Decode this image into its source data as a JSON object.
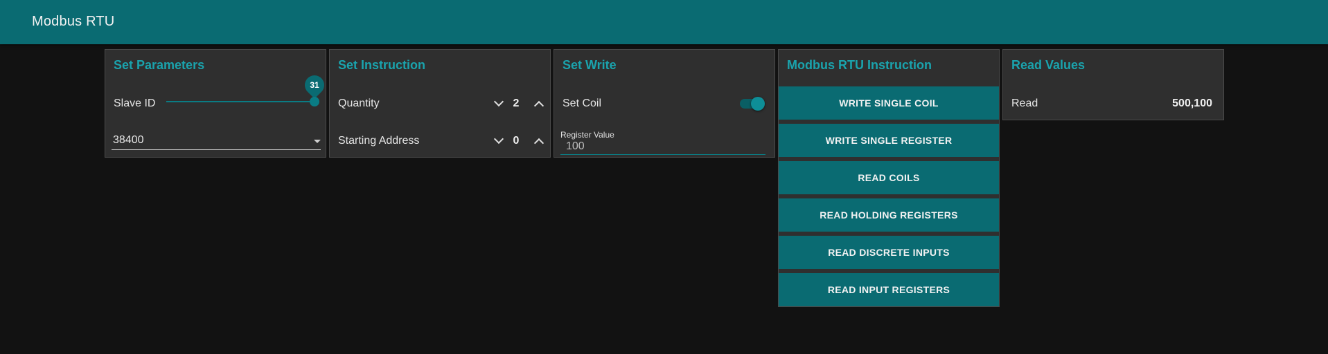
{
  "app": {
    "title": "Modbus RTU"
  },
  "set_parameters": {
    "title": "Set Parameters",
    "slave_id_label": "Slave ID",
    "slave_id_value": "31",
    "baud_rate": "38400"
  },
  "set_instruction": {
    "title": "Set Instruction",
    "quantity_label": "Quantity",
    "quantity_value": "2",
    "starting_address_label": "Starting Address",
    "starting_address_value": "0"
  },
  "set_write": {
    "title": "Set Write",
    "set_coil_label": "Set Coil",
    "set_coil_on": true,
    "register_value_label": "Register Value",
    "register_value": "100"
  },
  "instruction": {
    "title": "Modbus RTU Instruction",
    "buttons": [
      "WRITE SINGLE COIL",
      "WRITE SINGLE REGISTER",
      "READ COILS",
      "READ HOLDING REGISTERS",
      "READ DISCRETE INPUTS",
      "READ INPUT REGISTERS"
    ]
  },
  "read_values": {
    "title": "Read Values",
    "read_label": "Read",
    "read_value": "500,100"
  },
  "colors": {
    "accent": "#0a6b72",
    "title_text": "#1aa3ad",
    "background": "#121212",
    "card": "#2f2f2f"
  }
}
